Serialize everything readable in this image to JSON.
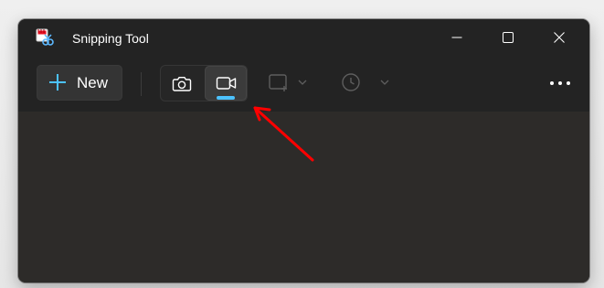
{
  "window": {
    "title": "Snipping Tool",
    "app_icon": "snipping-tool-icon"
  },
  "title_controls": {
    "minimize_icon": "minimize-icon",
    "maximize_icon": "maximize-icon",
    "close_icon": "close-icon"
  },
  "toolbar": {
    "new_label": "New",
    "new_icon": "plus-icon",
    "modes": [
      {
        "icon": "camera-icon",
        "selected": false
      },
      {
        "icon": "video-camera-icon",
        "selected": true
      }
    ],
    "shape_icon": "rectangle-snip-icon",
    "delay_icon": "clock-icon",
    "more_icon": "more-options-icon"
  },
  "colors": {
    "accent": "#4cc2ff",
    "annotation": "#ff0000",
    "window_bg": "#2d2b29",
    "toolbar_bg": "#232323"
  }
}
